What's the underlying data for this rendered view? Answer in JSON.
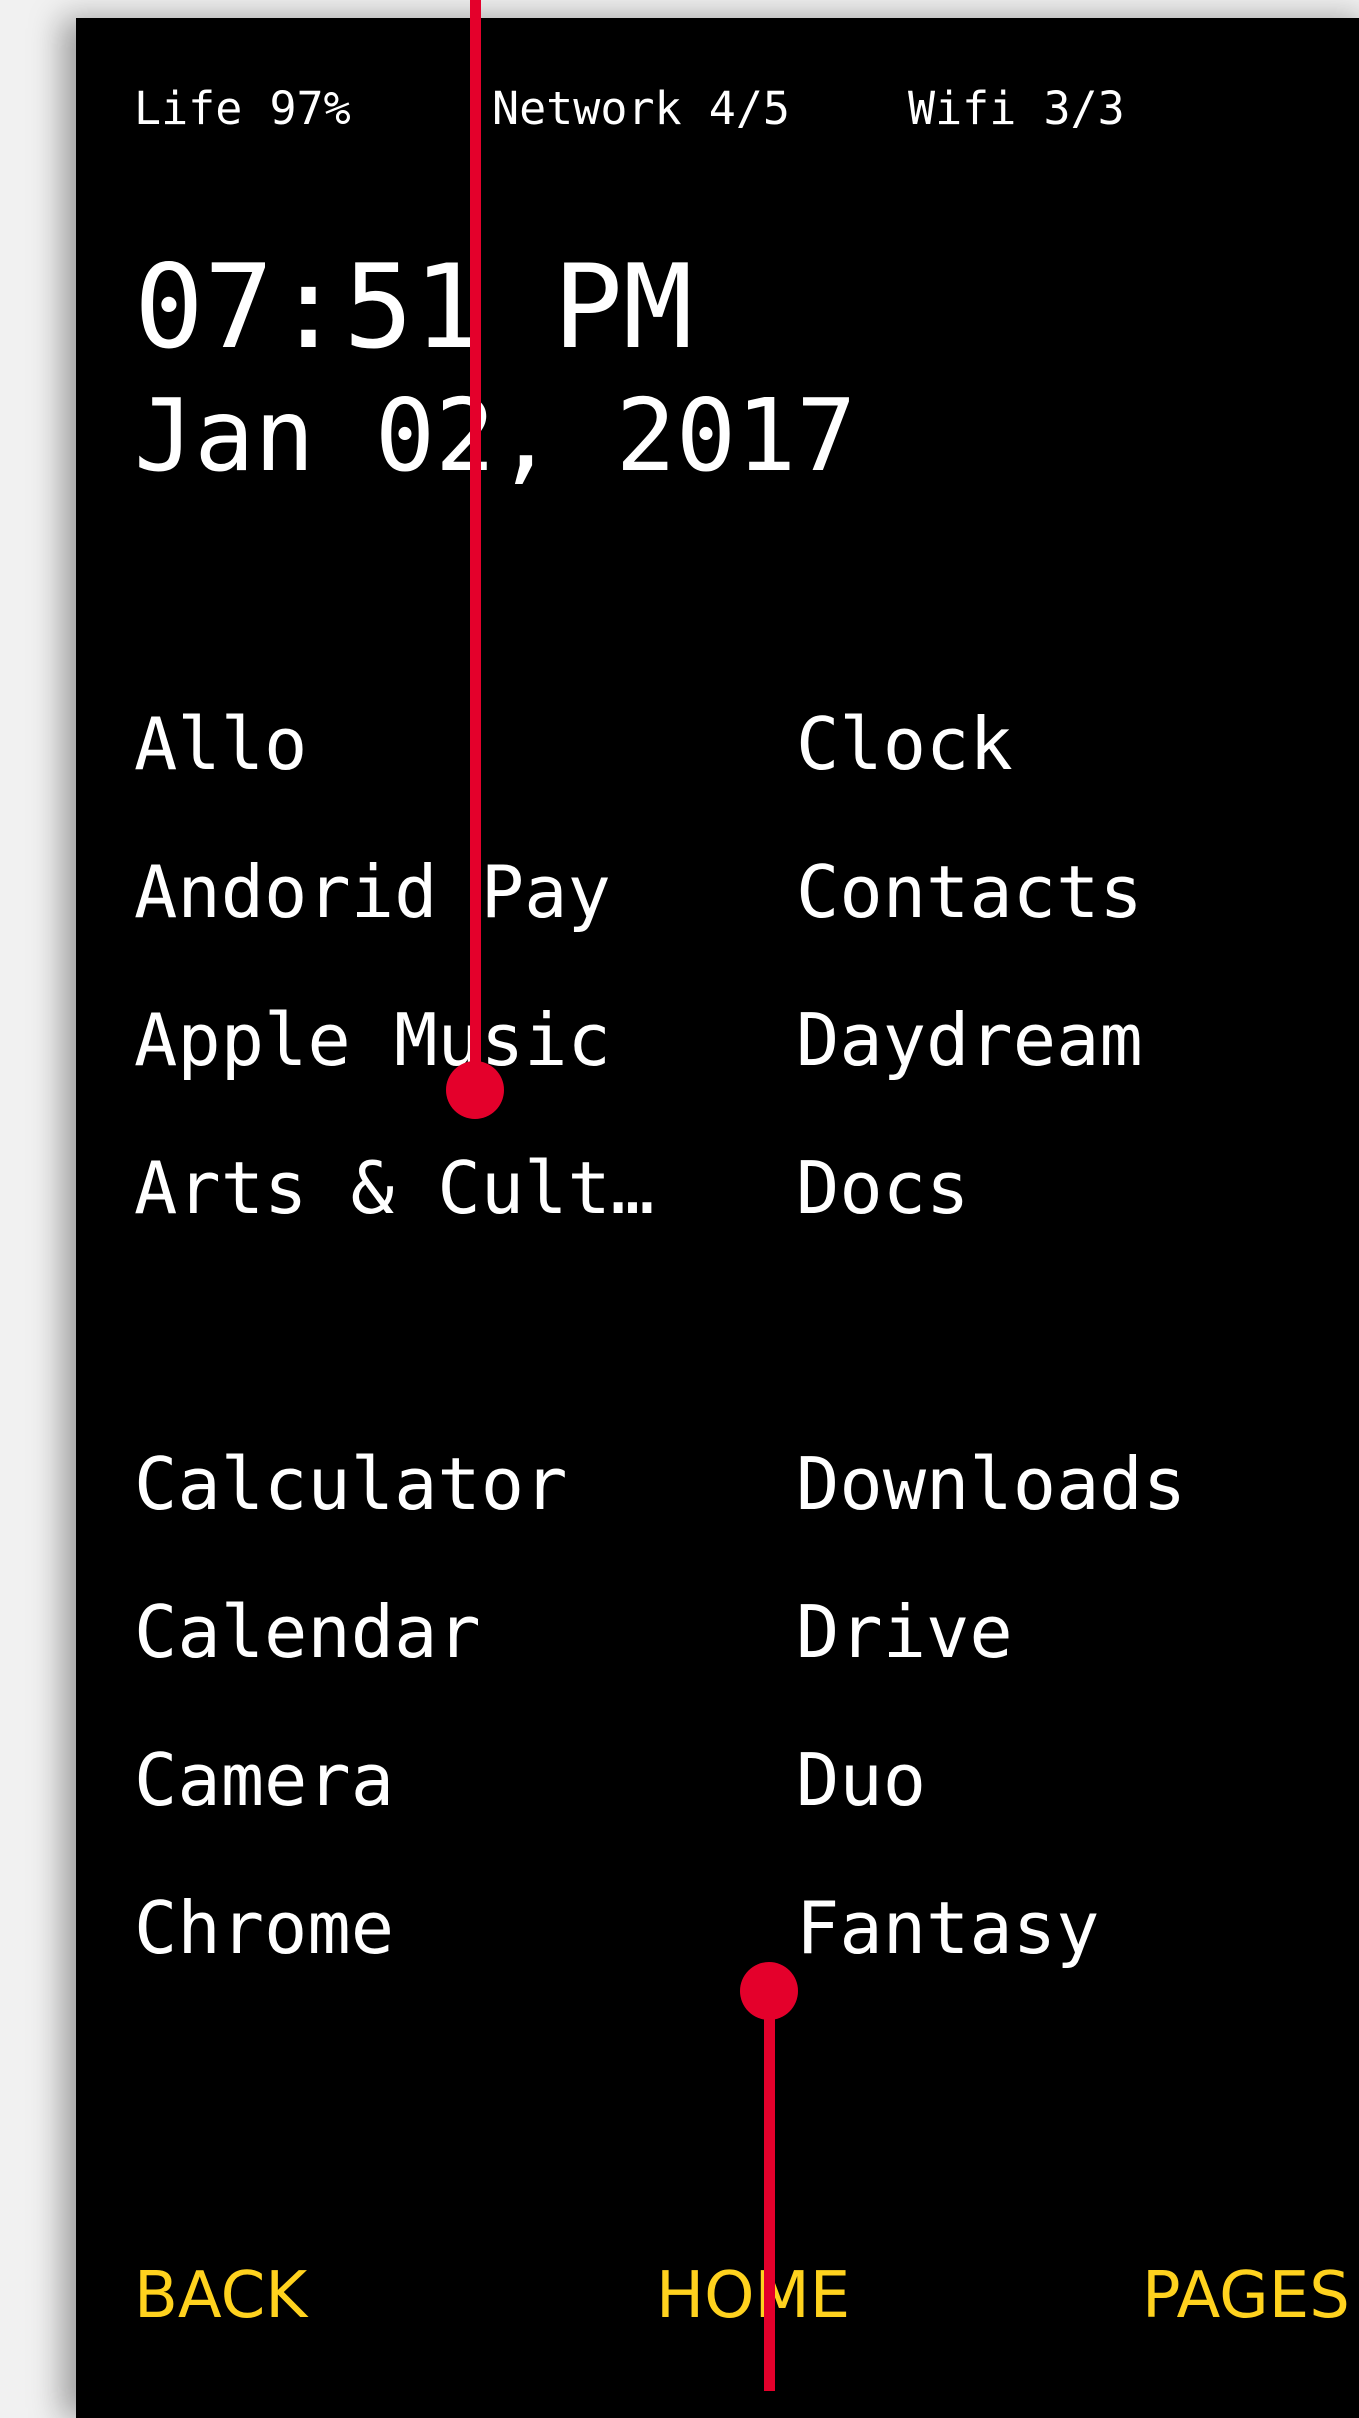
{
  "status_bar": {
    "life": "Life 97%",
    "network": "Network 4/5",
    "wifi": "Wifi 3/3"
  },
  "clock": {
    "time": "07:51 PM",
    "date": "Jan 02, 2017"
  },
  "apps_left_group1": [
    "Allo",
    "Andorid Pay",
    "Apple Music",
    "Arts & Cult…"
  ],
  "apps_right_group1": [
    "Clock",
    "Contacts",
    "Daydream",
    "Docs"
  ],
  "apps_left_group2": [
    "Calculator",
    "Calendar",
    "Camera",
    "Chrome"
  ],
  "apps_right_group2": [
    "Downloads",
    "Drive",
    "Duo",
    "Fantasy"
  ],
  "nav": {
    "back": "BACK",
    "home": "HOME",
    "pages": "PAGES"
  },
  "colors": {
    "background": "#000000",
    "text": "#ffffff",
    "nav_accent": "#ffd21e",
    "annotation": "#e4002b"
  }
}
